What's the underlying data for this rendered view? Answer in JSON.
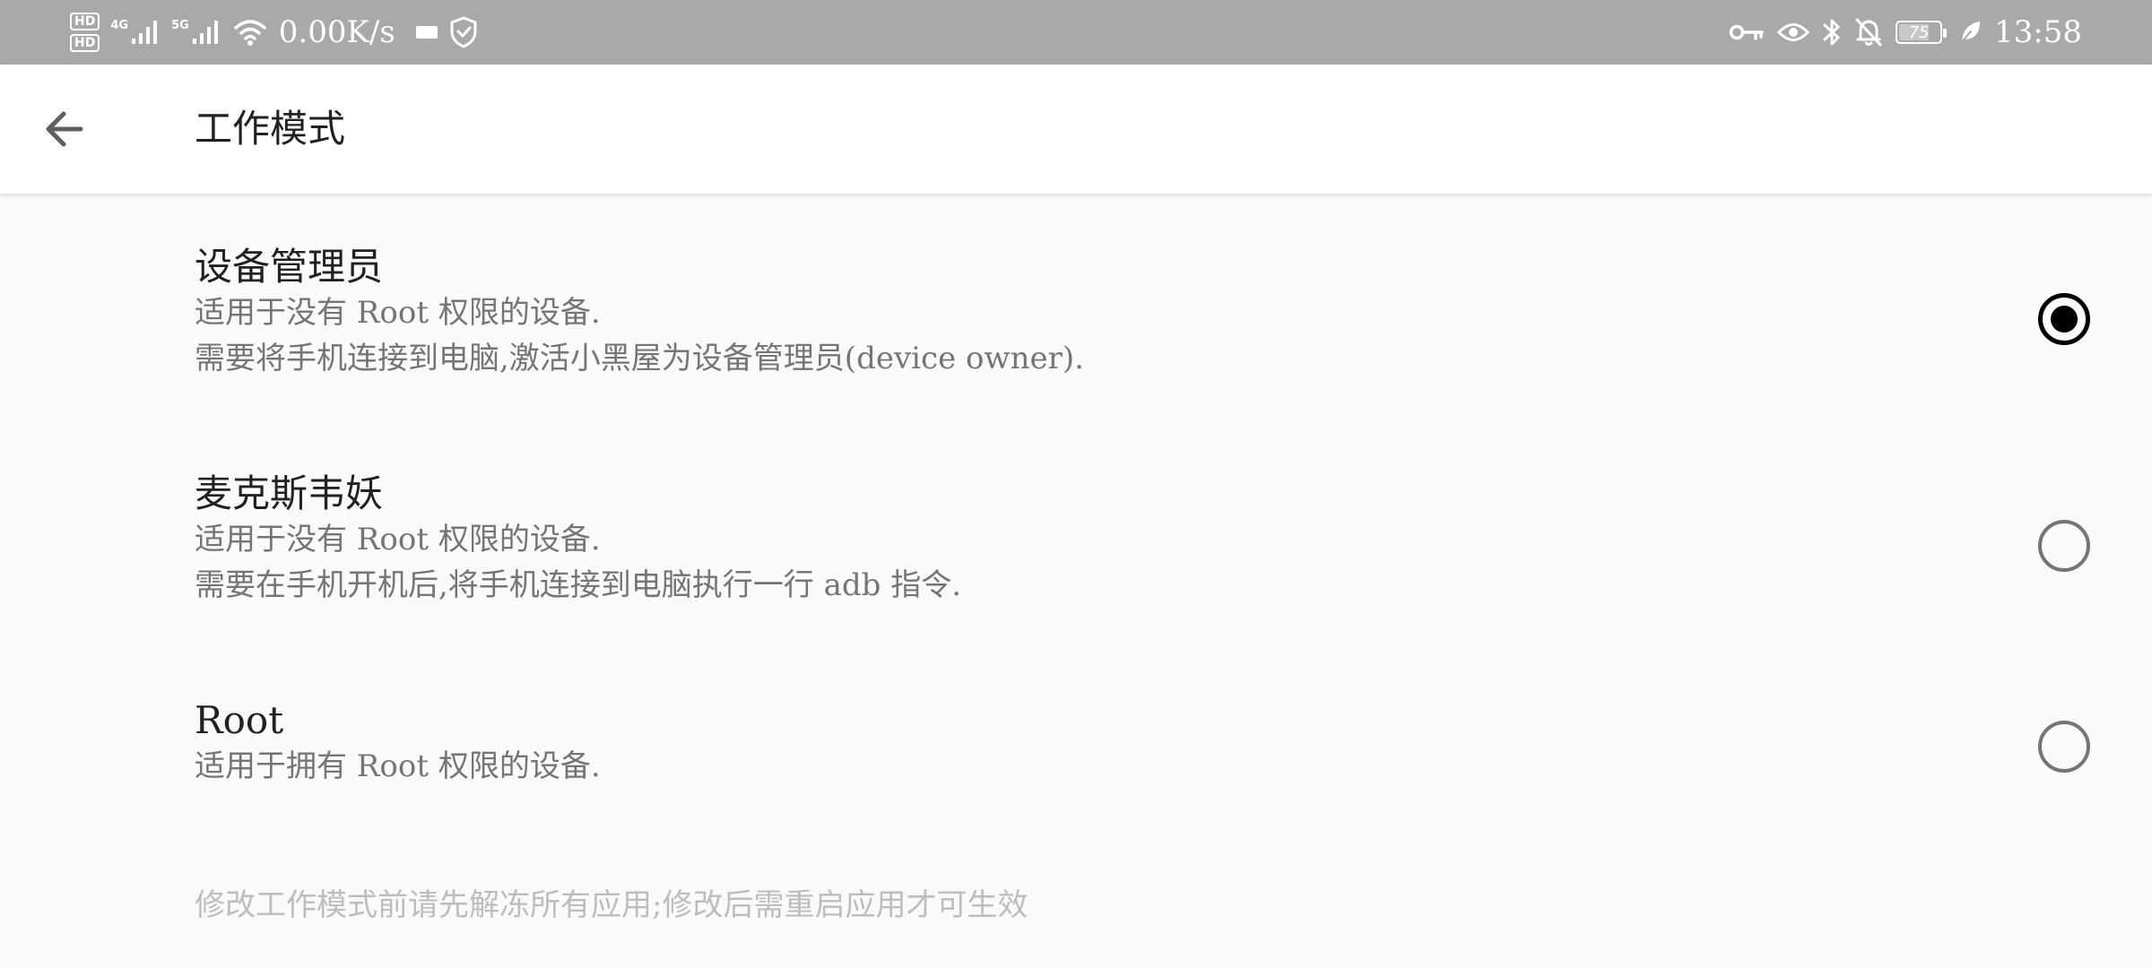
{
  "status_bar": {
    "hd1": "HD",
    "hd2": "HD",
    "network1": "4G",
    "network2": "5G",
    "speed": "0.00K/s",
    "battery_level": "75",
    "time": "13:58",
    "icons": [
      "hd-icon",
      "signal-4g-icon",
      "signal-5g-icon",
      "wifi-icon",
      "notification-icon",
      "shield-icon",
      "key-icon",
      "eye-icon",
      "bluetooth-icon",
      "bell-off-icon",
      "battery-icon",
      "leaf-icon"
    ]
  },
  "app_bar": {
    "title": "工作模式",
    "back_icon": "arrow-left-icon"
  },
  "options": [
    {
      "title": "设备管理员",
      "desc1": "适用于没有 Root 权限的设备.",
      "desc2": "需要将手机连接到电脑,激活小黑屋为设备管理员(device owner).",
      "selected": true
    },
    {
      "title": "麦克斯韦妖",
      "desc1": "适用于没有 Root 权限的设备.",
      "desc2": "需要在手机开机后,将手机连接到电脑执行一行 adb 指令.",
      "selected": false
    },
    {
      "title": "Root",
      "desc1": "适用于拥有 Root 权限的设备.",
      "selected": false
    }
  ],
  "footer_note": "修改工作模式前请先解冻所有应用;修改后需重启应用才可生效",
  "colors": {
    "status_bar_bg": "#a9a9a9",
    "app_bar_bg": "#ffffff",
    "page_bg": "#fafafa",
    "radio_selected": "#000000",
    "radio_unselected": "#757575",
    "primary_text": "#212121",
    "secondary_text": "#757575",
    "hint_text": "#bdbdbd"
  }
}
